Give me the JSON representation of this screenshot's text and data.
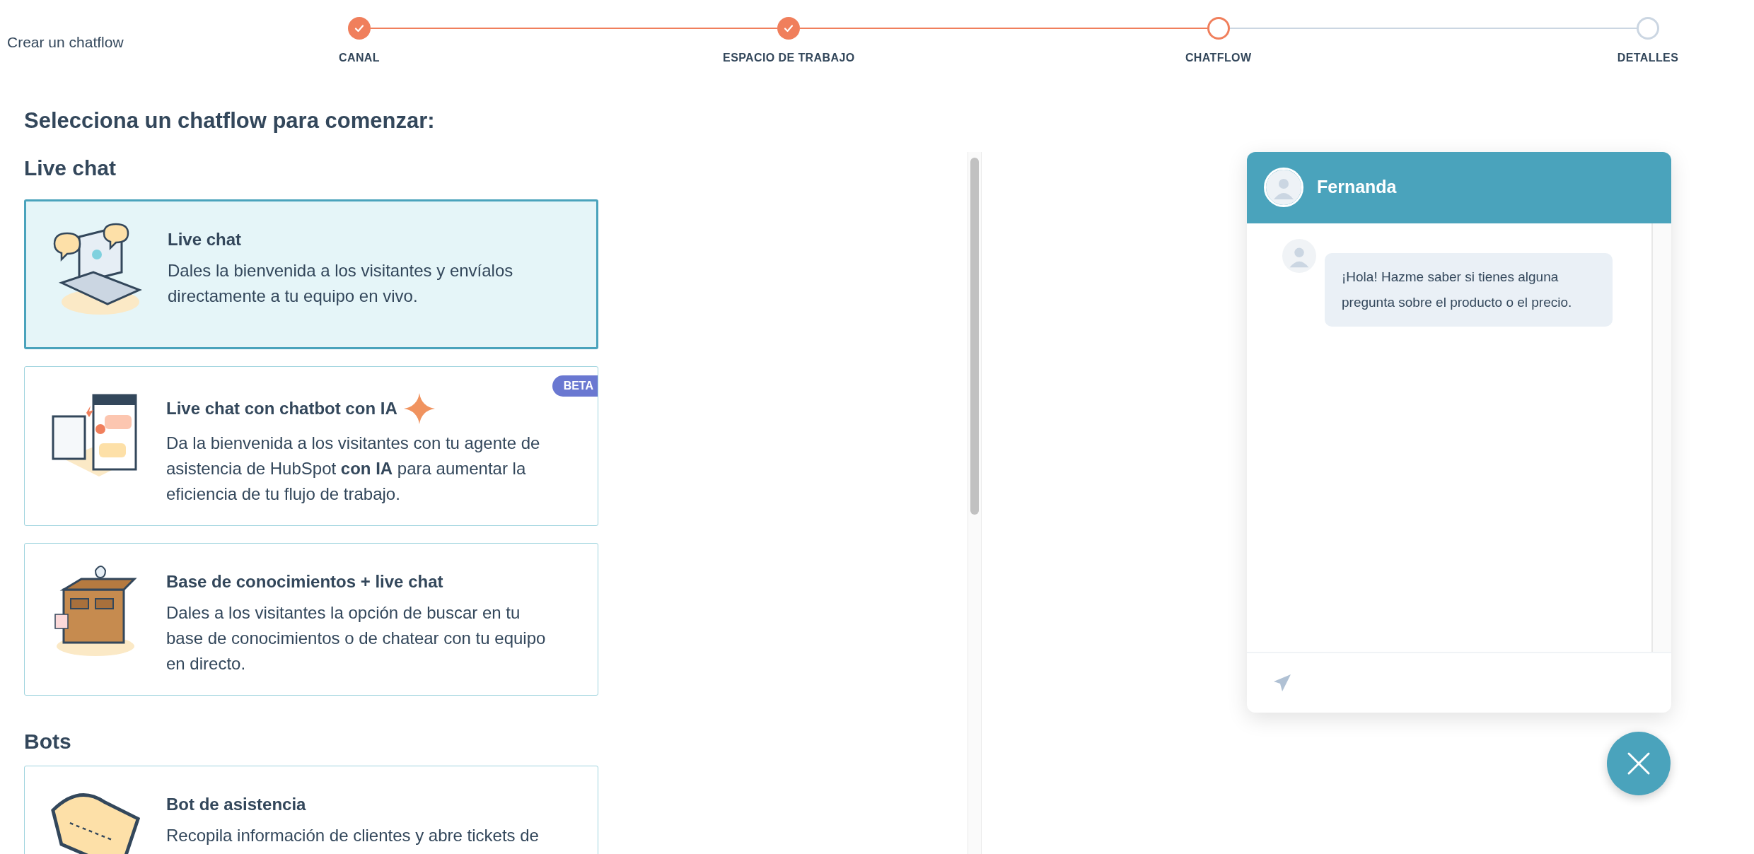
{
  "page_title": "Crear un chatflow",
  "steps": [
    {
      "label": "CANAL",
      "kind": "done"
    },
    {
      "label": "ESPACIO DE TRABAJO",
      "kind": "done"
    },
    {
      "label": "CHATFLOW",
      "kind": "current"
    },
    {
      "label": "DETALLES",
      "kind": "upcoming"
    }
  ],
  "heading": "Selecciona un chatflow para comenzar:",
  "sections": [
    {
      "title": "Live chat",
      "cards": [
        {
          "kind": "laptop",
          "title": "Live chat",
          "description": "Dales la bienvenida a los visitantes y envíalos directamente a tu equipo en vivo.",
          "selected": true
        },
        {
          "kind": "chat-windows",
          "title": "Live chat con chatbot con IA",
          "sparkle": true,
          "badge": "BETA",
          "description": "Da la bienvenida a los visitantes con tu agente de asistencia de HubSpot **con IA** para aumentar la eficiencia de tu flujo de trabajo.",
          "selected": false
        },
        {
          "kind": "cabinet",
          "title": "Base de conocimientos + live chat",
          "description": "Dales a los visitantes la opción de buscar en tu base de conocimientos o de chatear con tu equipo en directo.",
          "selected": false
        }
      ]
    },
    {
      "title": "Bots",
      "cards": [
        {
          "kind": "ticket",
          "title": "Bot de asistencia",
          "description": "Recopila información de clientes y abre tickets de",
          "selected": false
        }
      ]
    }
  ],
  "chat_preview": {
    "agent_name": "Fernanda",
    "message": "¡Hola! Hazme saber si tienes alguna pregunta sobre el producto o el precio."
  }
}
